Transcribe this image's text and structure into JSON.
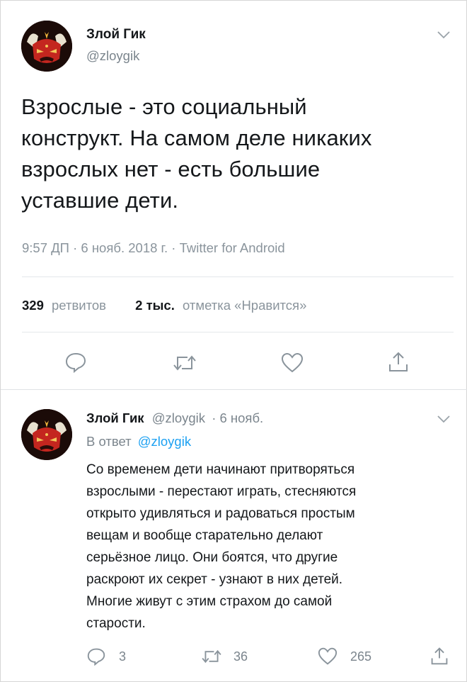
{
  "tweet": {
    "author_name": "Злой Гик",
    "author_handle": "@zloygik",
    "text_lines": [
      "Взрослые - это социальный",
      "конструкт. На самом деле никаких",
      "взрослых нет - есть большие",
      "уставшие дети."
    ],
    "meta": "9:57 ДП · 6 нояб. 2018 г. · Twitter for Android",
    "retweets_count": "329",
    "retweets_label": "ретвитов",
    "likes_count": "2 тыс.",
    "likes_label": "отметка «Нравится»",
    "actions": [
      "reply-icon",
      "retweet-icon",
      "like-icon",
      "share-icon"
    ]
  },
  "reply": {
    "author_name": "Злой Гик",
    "author_handle": "@zloygik",
    "date": "· 6 нояб.",
    "reply_prefix": "В ответ",
    "reply_mention": "@zloygik",
    "text_lines": [
      "Со временем дети начинают притворяться",
      "взрослыми - перестают играть, стесняются",
      "открыто удивляться и радоваться простым",
      "вещам и вообще старательно делают",
      "серьёзное лицо. Они боятся, что другие",
      "раскроют их секрет - узнают в них детей.",
      "Многие живут с этим страхом до самой",
      "старости."
    ],
    "reply_count": "3",
    "retweet_count": "36",
    "like_count": "265"
  },
  "colors": {
    "text": "#14171a",
    "secondary": "#7b858d",
    "mention": "#1da1f2",
    "icon": "#8a949c"
  }
}
